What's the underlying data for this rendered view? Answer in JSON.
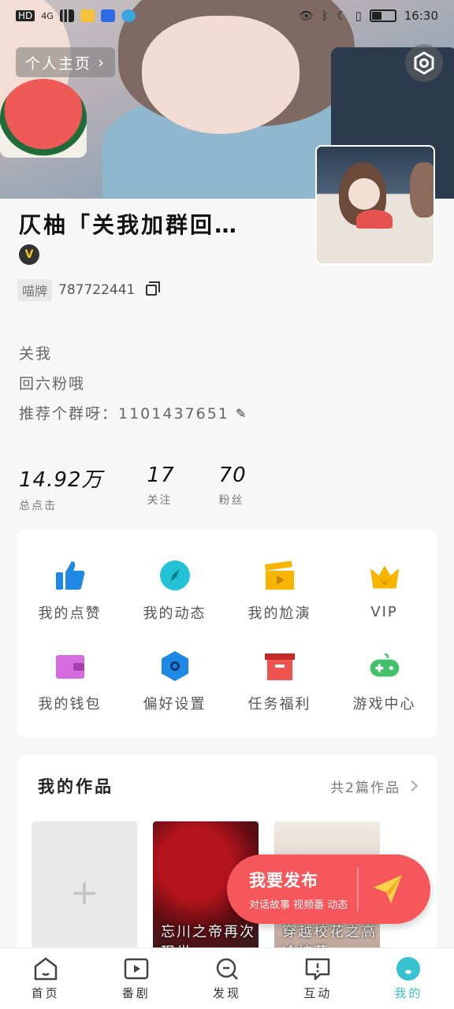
{
  "status_bar": {
    "left_badges": [
      "HD",
      "4G"
    ],
    "time": "16:30",
    "battery_level": 0.4
  },
  "header": {
    "profile_link_label": "个人主页",
    "settings_icon": "settings-icon"
  },
  "profile": {
    "name": "仄柚「关我加群回…",
    "badge_icon": "vip-crown-badge",
    "id_tag": "喵牌",
    "id_value": "787722441",
    "bio": [
      "关我",
      "回六粉哦",
      "推荐个群呀：1101437651"
    ],
    "stats": [
      {
        "value": "14.92万",
        "label": "总点击"
      },
      {
        "value": "17",
        "label": "关注"
      },
      {
        "value": "70",
        "label": "粉丝"
      }
    ]
  },
  "grid": [
    {
      "label": "我的点赞",
      "icon": "thumbs-up-icon",
      "color": "#1e88e5"
    },
    {
      "label": "我的动态",
      "icon": "compass-icon",
      "color": "#22c3d6"
    },
    {
      "label": "我的尬演",
      "icon": "clapperboard-icon",
      "color": "#f7b500"
    },
    {
      "label": "VIP",
      "icon": "crown-icon",
      "color": "#f7b500"
    },
    {
      "label": "我的钱包",
      "icon": "wallet-icon",
      "color": "#d66be0"
    },
    {
      "label": "偏好设置",
      "icon": "hexagon-settings-icon",
      "color": "#1e88e5"
    },
    {
      "label": "任务福利",
      "icon": "gift-box-icon",
      "color": "#ef5350"
    },
    {
      "label": "游戏中心",
      "icon": "gamepad-icon",
      "color": "#43c06a"
    }
  ],
  "works": {
    "title": "我的作品",
    "count_label": "共2篇作品",
    "items": [
      {
        "type": "add",
        "caption": "+"
      },
      {
        "type": "cover",
        "caption": "忘川之帝再次现世"
      },
      {
        "type": "cover",
        "caption": "穿越校花之高冷校草"
      }
    ]
  },
  "fab": {
    "title": "我要发布",
    "subtitle": "对话故事 视频番 动态"
  },
  "nav": [
    {
      "label": "首页",
      "icon": "home-icon",
      "active": false
    },
    {
      "label": "番剧",
      "icon": "play-icon",
      "active": false
    },
    {
      "label": "发现",
      "icon": "search-icon",
      "active": false
    },
    {
      "label": "互动",
      "icon": "chat-icon",
      "active": false
    },
    {
      "label": "我的",
      "icon": "profile-icon",
      "active": true
    }
  ]
}
